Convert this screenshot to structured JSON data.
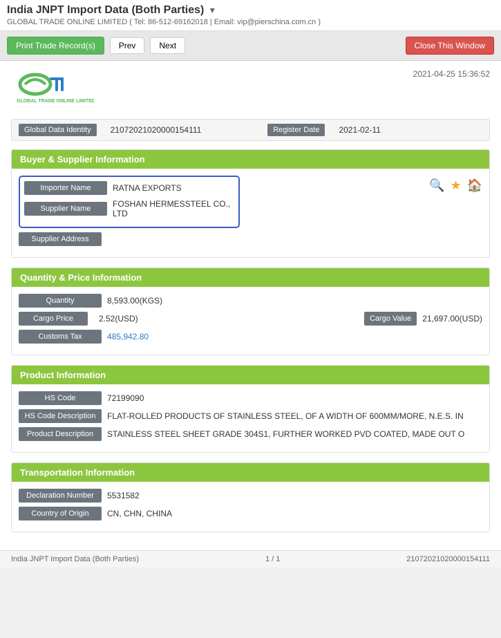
{
  "header": {
    "title": "India JNPT Import Data (Both Parties)",
    "subtitle": "GLOBAL TRADE ONLINE LIMITED ( Tel: 86-512-69162018 | Email: vip@pierschina.com.cn )",
    "timestamp": "2021-04-25 15:36:52"
  },
  "toolbar": {
    "print_label": "Print Trade Record(s)",
    "prev_label": "Prev",
    "next_label": "Next",
    "close_label": "Close This Window"
  },
  "meta": {
    "global_data_identity_label": "Global Data Identity",
    "global_data_identity_value": "21072021020000154111",
    "register_date_label": "Register Date",
    "register_date_value": "2021-02-11"
  },
  "buyer_supplier": {
    "section_title": "Buyer & Supplier Information",
    "importer_label": "Importer Name",
    "importer_value": "RATNA EXPORTS",
    "supplier_label": "Supplier Name",
    "supplier_value": "FOSHAN HERMESSTEEL CO., LTD",
    "supplier_address_label": "Supplier Address"
  },
  "quantity_price": {
    "section_title": "Quantity & Price Information",
    "quantity_label": "Quantity",
    "quantity_value": "8,593.00(KGS)",
    "cargo_price_label": "Cargo Price",
    "cargo_price_value": "2.52(USD)",
    "cargo_value_label": "Cargo Value",
    "cargo_value_value": "21,697.00(USD)",
    "customs_tax_label": "Customs Tax",
    "customs_tax_value": "485,942.80"
  },
  "product": {
    "section_title": "Product Information",
    "hs_code_label": "HS Code",
    "hs_code_value": "72199090",
    "hs_code_desc_label": "HS Code Description",
    "hs_code_desc_value": "FLAT-ROLLED PRODUCTS OF STAINLESS STEEL, OF A WIDTH OF 600MM/MORE, N.E.S. IN",
    "product_desc_label": "Product Description",
    "product_desc_value": "STAINLESS STEEL SHEET GRADE 304S1, FURTHER WORKED PVD COATED, MADE OUT O"
  },
  "transportation": {
    "section_title": "Transportation Information",
    "declaration_number_label": "Declaration Number",
    "declaration_number_value": "5531582",
    "country_of_origin_label": "Country of Origin",
    "country_of_origin_value": "CN, CHN, CHINA"
  },
  "footer": {
    "left": "India JNPT Import Data (Both Parties)",
    "middle": "1 / 1",
    "right": "21072021020000154111"
  },
  "icons": {
    "search": "🔍",
    "star": "★",
    "home": "🏠",
    "dropdown": "▼"
  }
}
